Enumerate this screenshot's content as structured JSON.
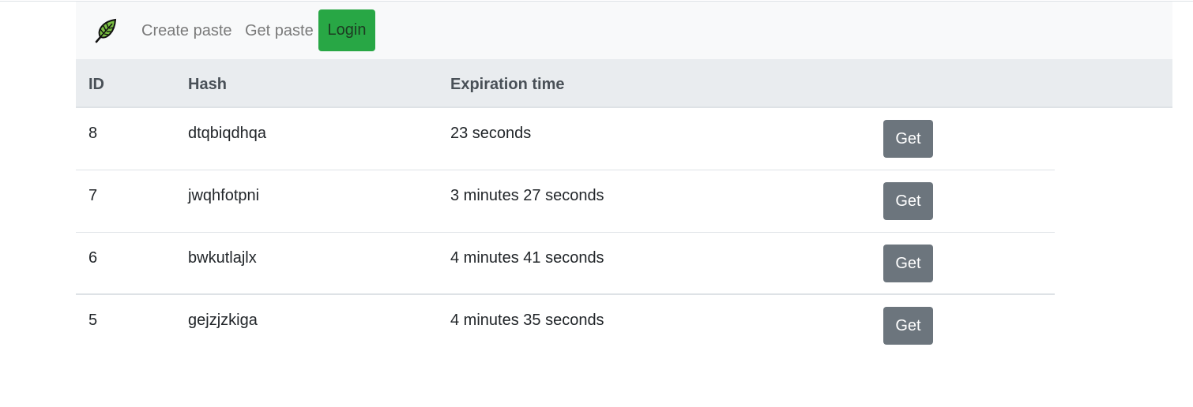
{
  "nav": {
    "brand_icon": "leaf-icon",
    "create_paste": "Create paste",
    "get_paste": "Get paste",
    "login": "Login"
  },
  "table": {
    "headers": {
      "id": "ID",
      "hash": "Hash",
      "expiration": "Expiration time"
    },
    "rows": [
      {
        "id": "8",
        "hash": "dtqbiqdhqa",
        "expiration": "23 seconds",
        "action": "Get"
      },
      {
        "id": "7",
        "hash": "jwqhfotpni",
        "expiration": "3 minutes 27 seconds",
        "action": "Get"
      },
      {
        "id": "6",
        "hash": "bwkutlajlx",
        "expiration": "4 minutes 41 seconds",
        "action": "Get"
      },
      {
        "id": "5",
        "hash": "gejzjzkiga",
        "expiration": "4 minutes 35 seconds",
        "action": "Get"
      }
    ]
  },
  "colors": {
    "login_button": "#28a745",
    "get_button": "#6c757d",
    "navbar_bg": "#f8f9fa",
    "table_head_bg": "#e9ecef"
  }
}
